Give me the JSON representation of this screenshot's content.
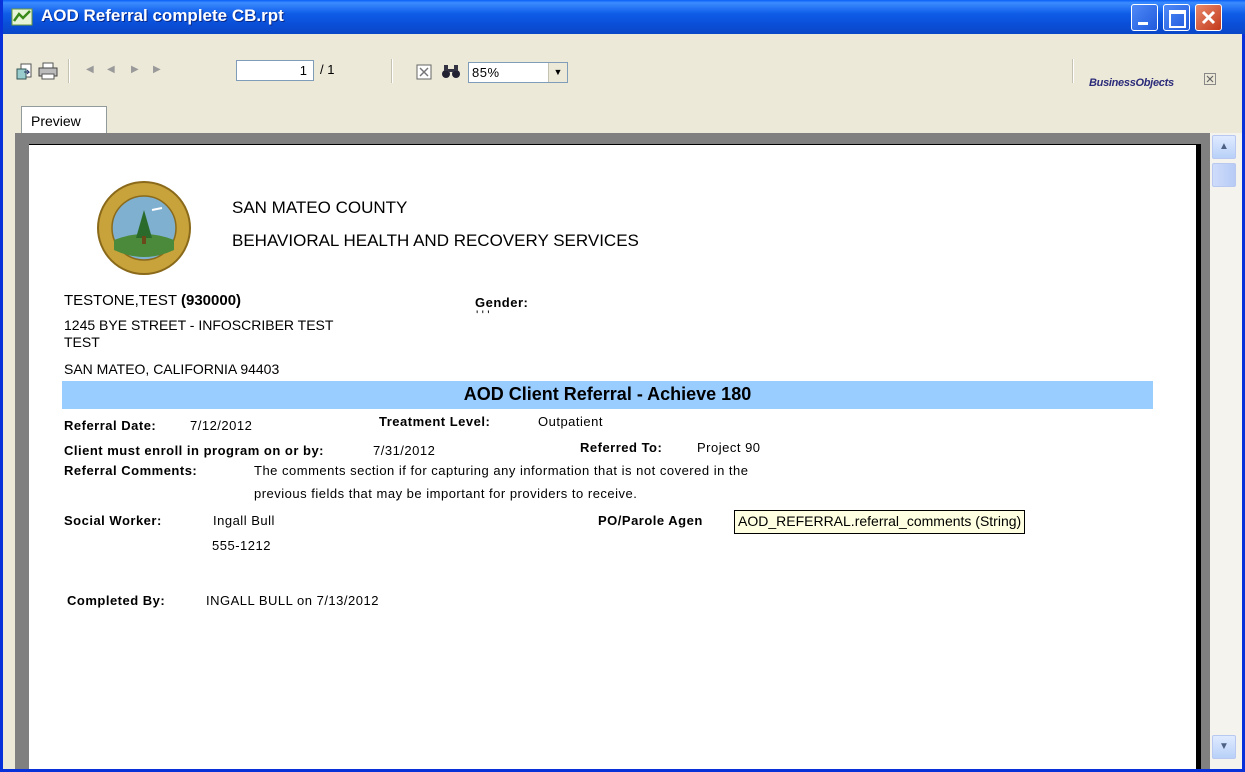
{
  "window": {
    "title": "AOD Referral complete CB.rpt"
  },
  "toolbar": {
    "current_page": "1",
    "total_pages": "/ 1",
    "zoom": "85%",
    "brand": "BusinessObjects"
  },
  "tab": {
    "label": "Preview"
  },
  "report": {
    "org_line1": "SAN MATEO COUNTY",
    "org_line2": "BEHAVIORAL HEALTH AND RECOVERY SERVICES",
    "seal_text_top": "COUNTY OF SAN MATEO",
    "seal_text_bottom": "FOUNDED 1856",
    "client_name": "TESTONE,TEST",
    "client_id": "(930000)",
    "address_line1": "1245 BYE STREET - INFOSCRIBER TEST",
    "address_line2": "TEST",
    "address_line3": "SAN MATEO, CALIFORNIA  94403",
    "gender_label": "Gender:",
    "gender_value": "' '  '",
    "banner_title": "AOD Client Referral - Achieve 180",
    "referral_date_label": "Referral Date:",
    "referral_date": "7/12/2012",
    "treatment_level_label": "Treatment Level:",
    "treatment_level": "Outpatient",
    "enroll_label": "Client must enroll in program on or by:",
    "enroll_date": "7/31/2012",
    "referred_to_label": "Referred To:",
    "referred_to": "Project 90",
    "comments_label": "Referral Comments:",
    "comments_line1": "The comments section if for capturing any information that is not covered in the",
    "comments_line2": "previous fields that may be important for providers to receive.",
    "social_worker_label": "Social Worker:",
    "social_worker": "Ingall Bull",
    "social_worker_phone": "555-1212",
    "po_label": "PO/Parole Agen",
    "completed_by_label": "Completed By:",
    "completed_by": "INGALL BULL on 7/13/2012",
    "tooltip": "AOD_REFERRAL.referral_comments (String)"
  }
}
